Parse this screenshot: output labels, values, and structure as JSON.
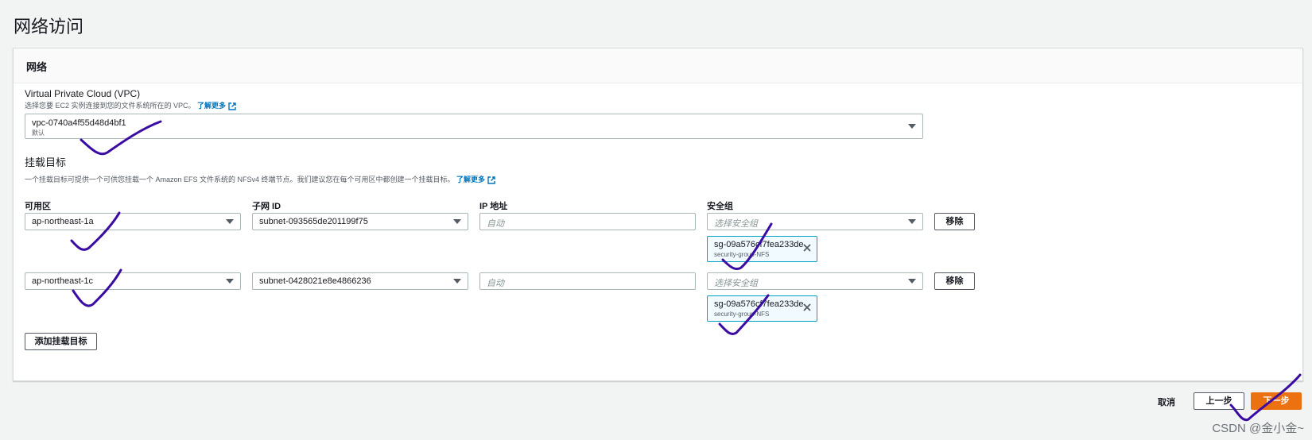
{
  "page": {
    "title": "网络访问"
  },
  "network": {
    "title": "网络",
    "vpc": {
      "label": "Virtual Private Cloud (VPC)",
      "desc": "选择您要 EC2 实例连接到您的文件系统所在的 VPC。",
      "learn_more": "了解更多",
      "value": "vpc-0740a4f55d48d4bf1",
      "sub": "默认"
    },
    "mount": {
      "title": "挂载目标",
      "desc": "一个挂载目标可提供一个可供您挂载一个 Amazon EFS 文件系统的 NFSv4 终端节点。我们建议您在每个可用区中都创建一个挂载目标。",
      "learn_more": "了解更多",
      "columns": {
        "az": "可用区",
        "subnet": "子网 ID",
        "ip": "IP 地址",
        "sg": "安全组"
      },
      "rows": [
        {
          "az": "ap-northeast-1a",
          "subnet": "subnet-093565de201199f75",
          "ip_placeholder": "自动",
          "sg_placeholder": "选择安全组",
          "remove": "移除",
          "token_id": "sg-09a576cf7fea233de",
          "token_name": "security-group-NFS"
        },
        {
          "az": "ap-northeast-1c",
          "subnet": "subnet-0428021e8e4866236",
          "ip_placeholder": "自动",
          "sg_placeholder": "选择安全组",
          "remove": "移除",
          "token_id": "sg-09a576cf7fea233de",
          "token_name": "security-group-NFS"
        }
      ],
      "add_button": "添加挂载目标"
    }
  },
  "footer": {
    "cancel": "取消",
    "previous": "上一步",
    "next": "下一步"
  },
  "watermark": "CSDN @金小金~",
  "colors": {
    "primary": "#ec7211",
    "link": "#0073bb",
    "token_bg": "#f1faff",
    "annotation": "#3a0ca3"
  }
}
